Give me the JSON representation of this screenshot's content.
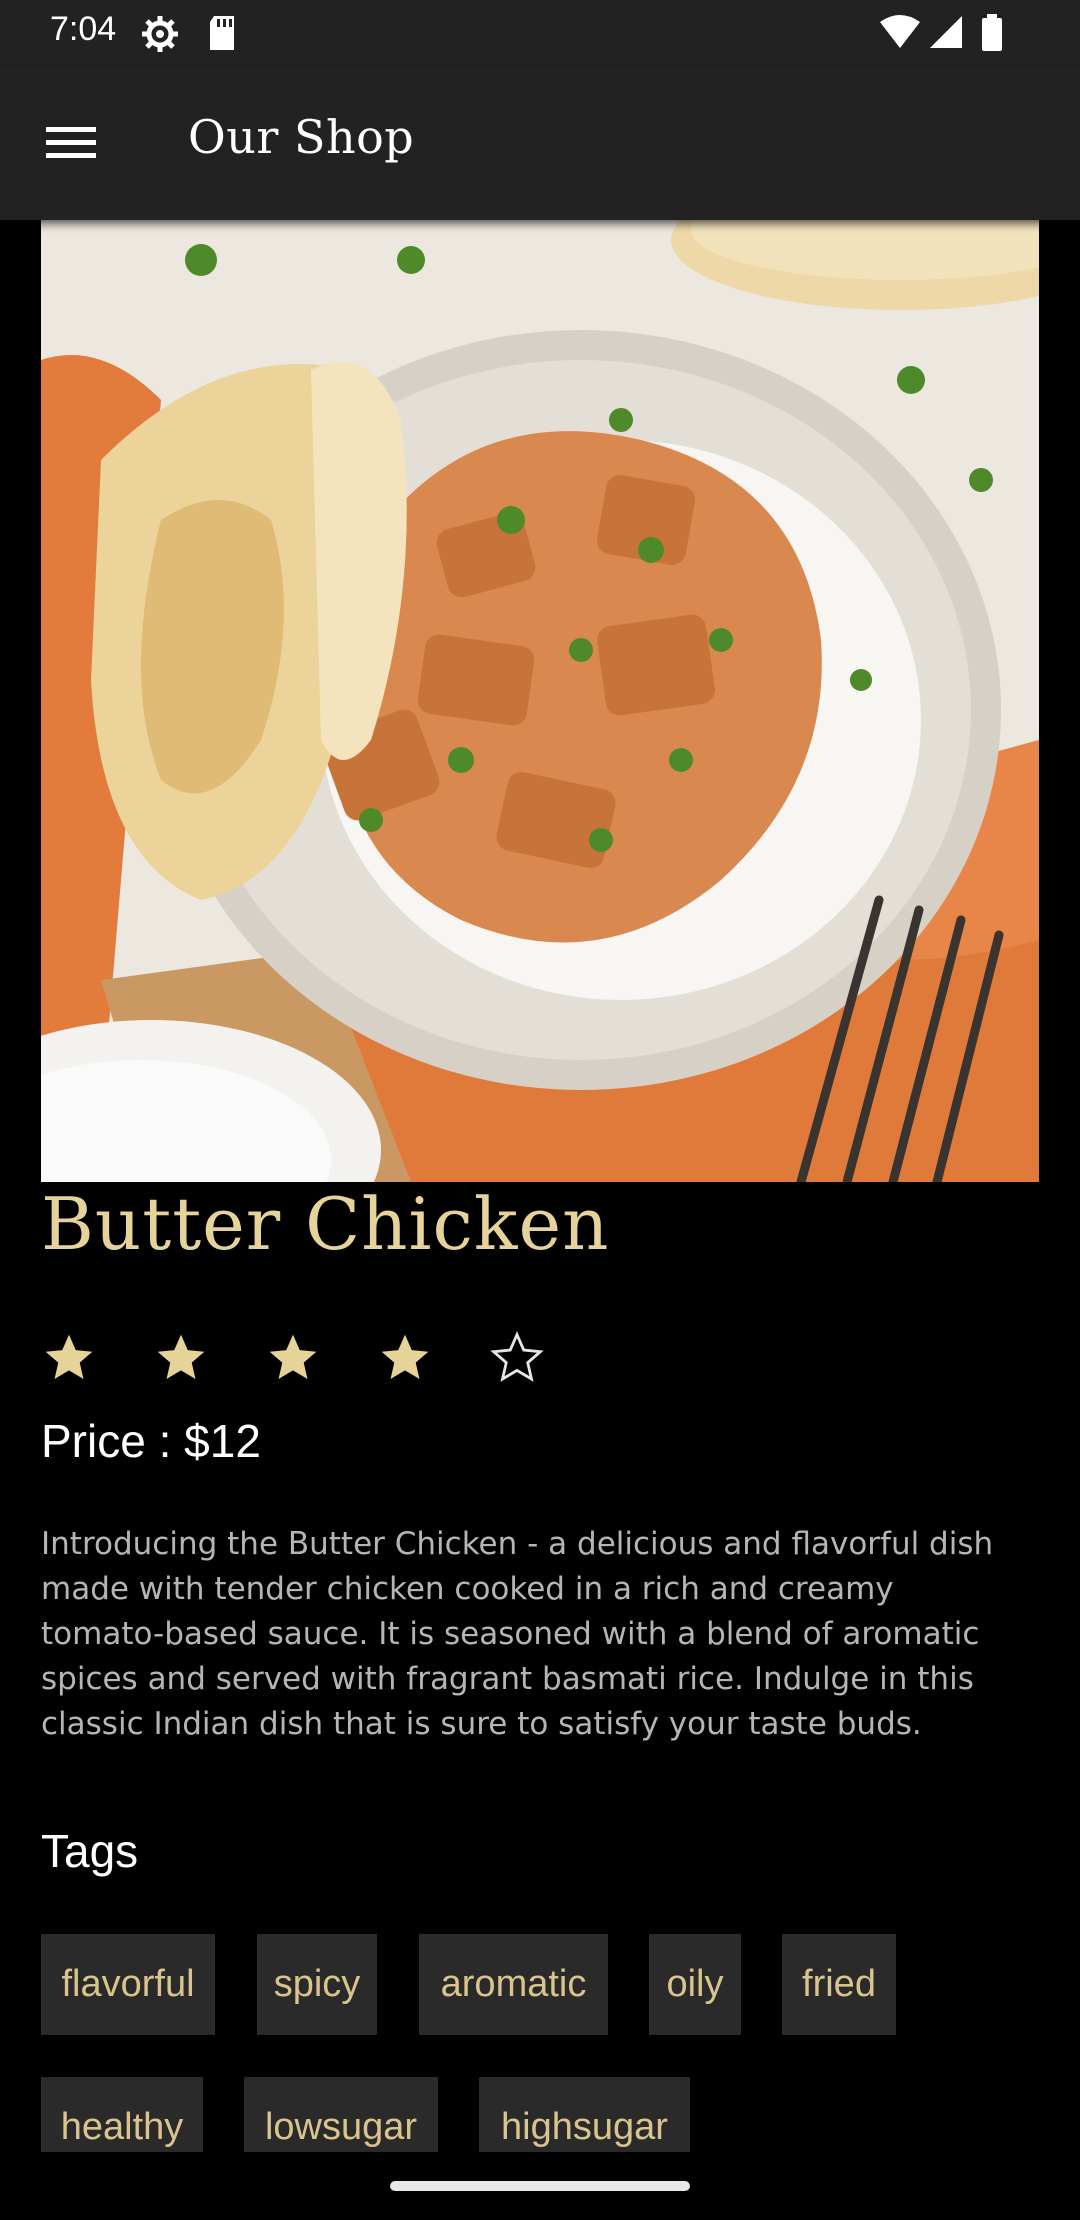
{
  "status_bar": {
    "time": "7:04",
    "icons": [
      "settings-icon",
      "sd-card-icon",
      "wifi-icon",
      "signal-icon",
      "battery-icon"
    ]
  },
  "app_bar": {
    "title": "Our Shop",
    "menu_icon": "hamburger-menu-icon"
  },
  "product": {
    "title": "Butter Chicken",
    "rating": {
      "value": 4,
      "max": 5
    },
    "price_label": "Price : ",
    "price_value": "$12",
    "description": "Introducing the Butter Chicken - a delicious and flavorful dish made with tender chicken cooked in a rich and creamy tomato-based sauce. It is seasoned with a blend of aromatic spices and served with fragrant basmati rice. Indulge in this classic Indian dish that is sure to satisfy your taste buds."
  },
  "tags": {
    "heading": "Tags",
    "items": [
      "flavorful",
      "spicy",
      "aromatic",
      "oily",
      "fried",
      "healthy",
      "lowsugar",
      "highsugar"
    ]
  },
  "colors": {
    "accent_gold": "#e6d39a",
    "tag_text": "#d8c48c",
    "tag_bg": "#2a2a2a",
    "bar_bg": "#222222",
    "background": "#000000"
  }
}
